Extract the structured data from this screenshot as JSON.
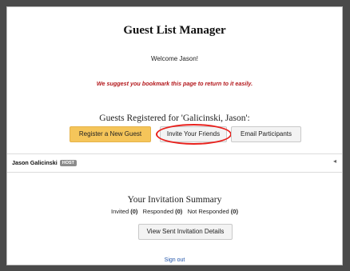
{
  "header": {
    "title": "Guest List Manager",
    "welcome": "Welcome Jason!",
    "bookmark_note": "We suggest you bookmark this page to return to it easily."
  },
  "guests": {
    "heading": "Guests Registered for 'Galicinski, Jason':",
    "register_label": "Register a New Guest",
    "invite_label": "Invite Your Friends",
    "email_label": "Email Participants",
    "host_name": "Jason Galicinski",
    "host_badge": "HOST",
    "collapse_glyph": "◂"
  },
  "summary": {
    "heading": "Your Invitation Summary",
    "invited_label": "Invited",
    "invited_count": "(0)",
    "responded_label": "Responded",
    "responded_count": "(0)",
    "not_responded_label": "Not Responded",
    "not_responded_count": "(0)",
    "view_label": "View Sent Invitation Details"
  },
  "footer": {
    "signout_label": "Sign out"
  },
  "colors": {
    "accent_button": "#f5c55a",
    "highlight_oval": "#e8201c",
    "note_text": "#b3171b",
    "link": "#2255aa"
  }
}
